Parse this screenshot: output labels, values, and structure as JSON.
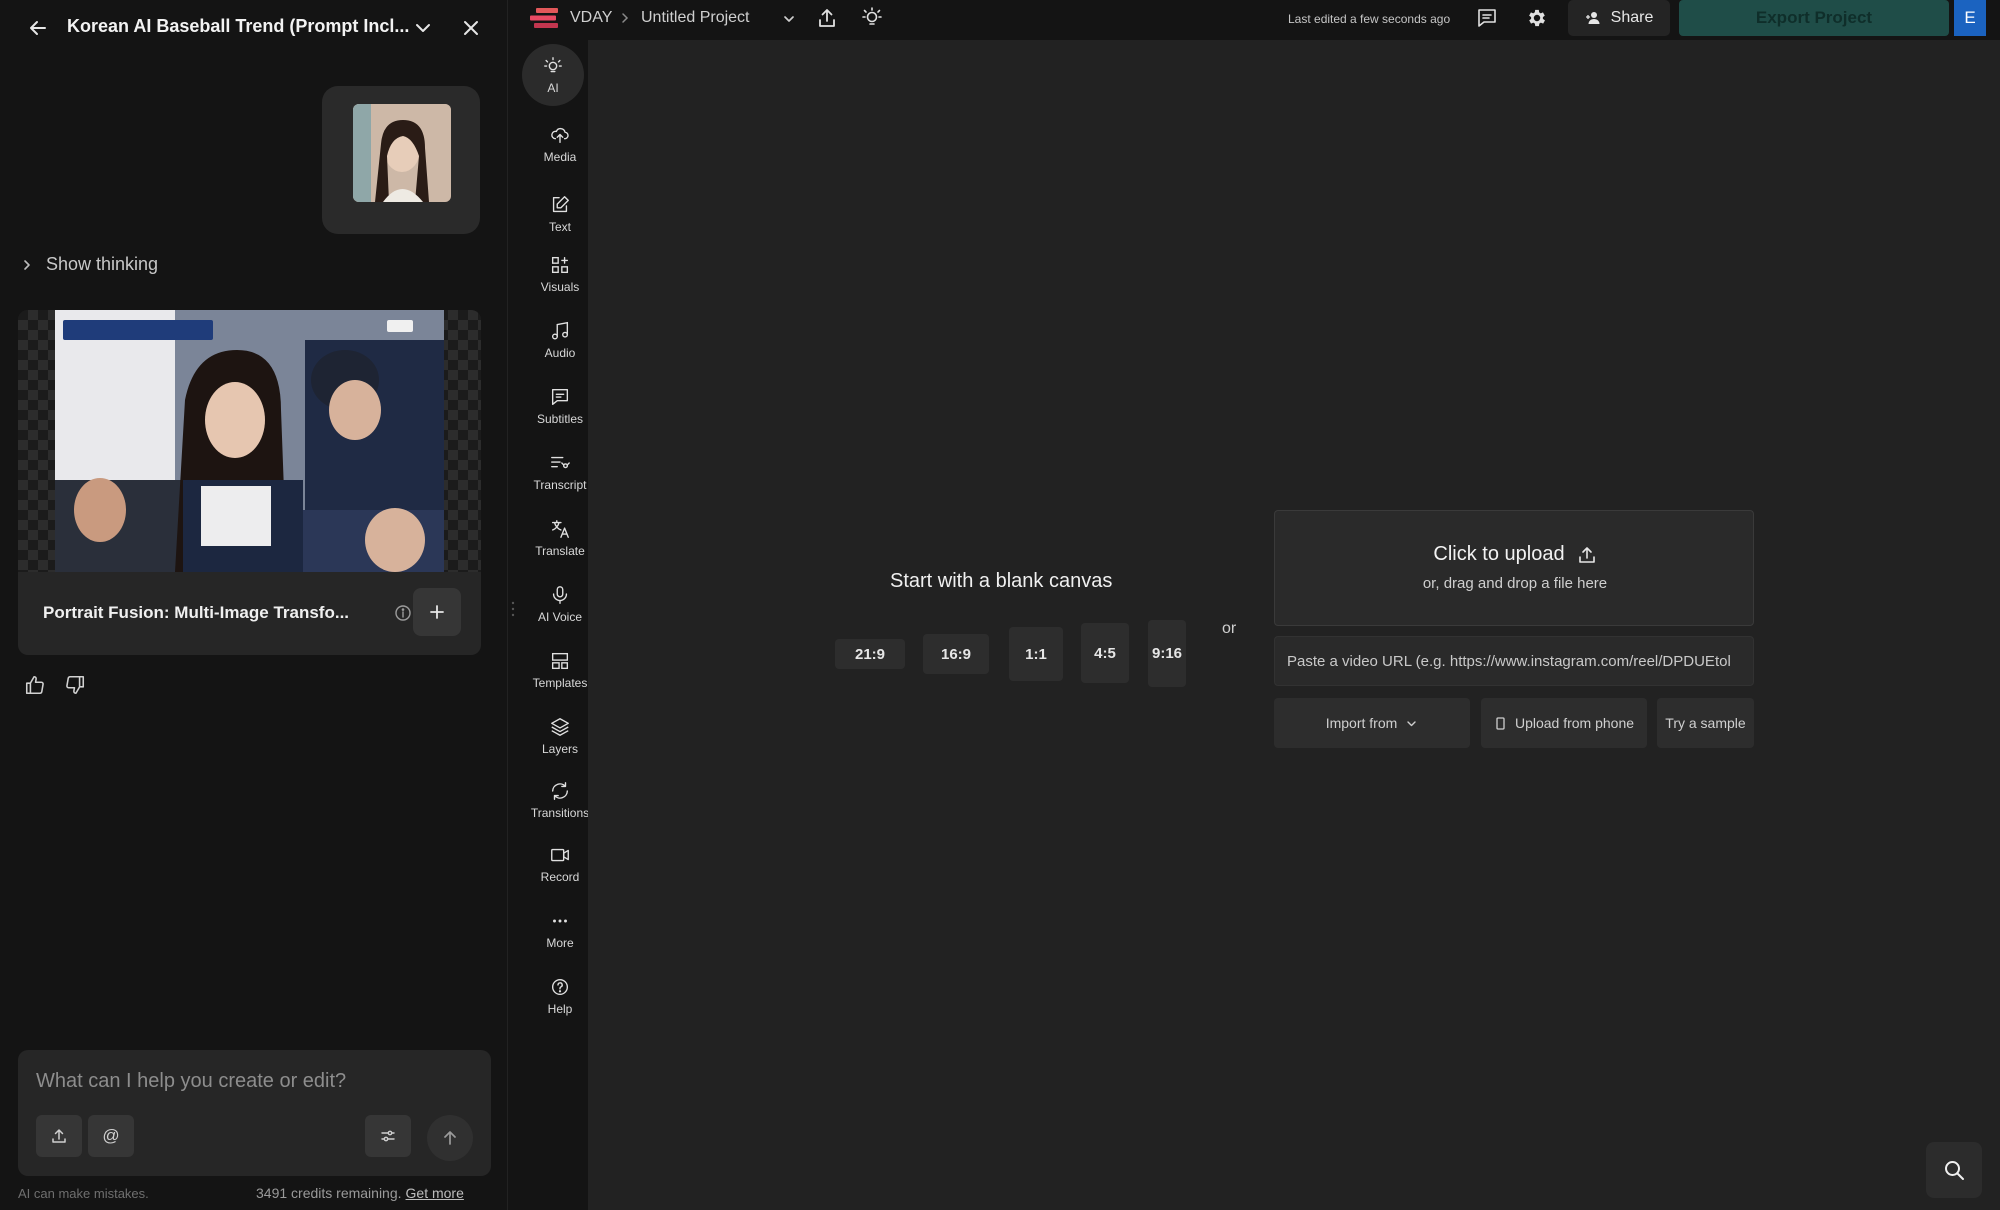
{
  "panel": {
    "title": "Korean AI Baseball Trend (Prompt Incl...",
    "show_thinking": "Show thinking",
    "result_caption": "Portrait Fusion: Multi-Image Transfo...",
    "chat_placeholder": "What can I help you create or edit?",
    "disclaimer": "AI can make mistakes.",
    "credits_text": "3491 credits remaining.",
    "get_more": "Get more"
  },
  "tools": [
    {
      "label": "AI",
      "icon": "bulb-icon"
    },
    {
      "label": "Media",
      "icon": "cloud-upload-icon"
    },
    {
      "label": "Text",
      "icon": "edit-icon"
    },
    {
      "label": "Visuals",
      "icon": "shapes-icon"
    },
    {
      "label": "Audio",
      "icon": "music-note-icon"
    },
    {
      "label": "Subtitles",
      "icon": "subtitles-icon"
    },
    {
      "label": "Transcript",
      "icon": "transcript-icon"
    },
    {
      "label": "Translate",
      "icon": "translate-icon"
    },
    {
      "label": "AI Voice",
      "icon": "microphone-icon"
    },
    {
      "label": "Templates",
      "icon": "templates-icon"
    },
    {
      "label": "Layers",
      "icon": "layers-icon"
    },
    {
      "label": "Transitions",
      "icon": "transitions-icon"
    },
    {
      "label": "Record",
      "icon": "camera-icon"
    },
    {
      "label": "More",
      "icon": "more-dots-icon"
    },
    {
      "label": "Help",
      "icon": "help-icon"
    }
  ],
  "topbar": {
    "brand": "VDAY",
    "project_name": "Untitled Project",
    "last_edited": "Last edited a few seconds ago",
    "share_label": "Share",
    "export_label": "Export Project",
    "avatar_initial": "E"
  },
  "canvas": {
    "blank_title": "Start with a blank canvas",
    "ratios": [
      "21:9",
      "16:9",
      "1:1",
      "4:5",
      "9:16"
    ],
    "or_label": "or",
    "upload_title": "Click to upload",
    "upload_sub": "or, drag and drop a file here",
    "url_placeholder": "Paste a video URL (e.g. https://www.instagram.com/reel/DPDUEtol",
    "import_from": "Import from",
    "upload_from_phone": "Upload from phone",
    "try_sample": "Try a sample"
  },
  "colors": {
    "background": "#222222",
    "panel": "#141414",
    "export_button": "#1f4d48",
    "avatar": "#1b63c0"
  }
}
